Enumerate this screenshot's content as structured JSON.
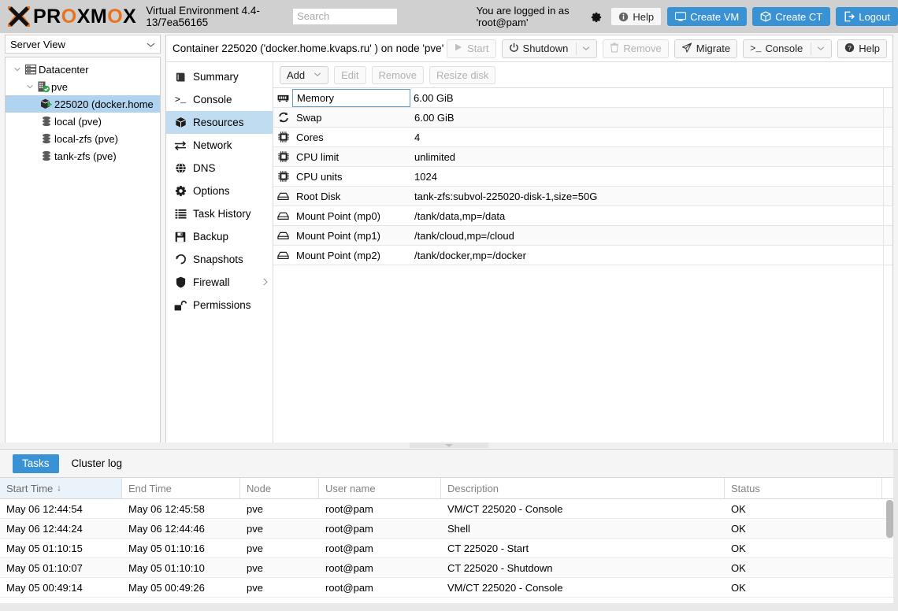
{
  "header": {
    "brand_black": "PR",
    "brand_orange_1": "O",
    "brand_black_2": "XM",
    "brand_orange_2": "O",
    "brand_black_3": "X",
    "wordmark": "PROXMOX",
    "product_name": "Virtual Environment 4.4-13/7ea56165",
    "search_placeholder": "Search",
    "search_value": "",
    "login_text": "You are logged in as 'root@pam'",
    "gear_icon": "gear-icon",
    "buttons": [
      {
        "label": "Help",
        "icon": "info-icon",
        "style": "light"
      },
      {
        "label": "Create VM",
        "icon": "monitor-icon",
        "style": "blue"
      },
      {
        "label": "Create CT",
        "icon": "cube-icon",
        "style": "blue"
      },
      {
        "label": "Logout",
        "icon": "logout-icon",
        "style": "blue"
      }
    ],
    "accent_color": "#3892d4",
    "brand_color": "#e8731c",
    "bar_color": "#d0d0d0"
  },
  "sidebar": {
    "view_selector": "Server View",
    "tree": [
      {
        "label": "Datacenter",
        "icon": "datacenter-icon",
        "indent": 0,
        "expanded": true,
        "selected": false
      },
      {
        "label": "pve",
        "icon": "node-icon",
        "indent": 1,
        "expanded": true,
        "selected": false
      },
      {
        "label": "225020 (docker.home",
        "icon": "container-icon",
        "indent": 2,
        "expanded": false,
        "selected": true
      },
      {
        "label": "local (pve)",
        "icon": "storage-icon",
        "indent": 2,
        "expanded": false,
        "selected": false
      },
      {
        "label": "local-zfs (pve)",
        "icon": "storage-icon",
        "indent": 2,
        "expanded": false,
        "selected": false
      },
      {
        "label": "tank-zfs (pve)",
        "icon": "storage-icon",
        "indent": 2,
        "expanded": false,
        "selected": false
      }
    ]
  },
  "content": {
    "title": "Container 225020 ('docker.home.kvaps.ru' ) on node 'pve'",
    "toolbar": [
      {
        "label": "Start",
        "icon": "play-icon",
        "disabled": true,
        "split": false
      },
      {
        "label": "Shutdown",
        "icon": "power-icon",
        "disabled": false,
        "split": true
      },
      {
        "label": "Remove",
        "icon": "trash-icon",
        "disabled": true,
        "split": false
      },
      {
        "label": "Migrate",
        "icon": "migrate-icon",
        "disabled": false,
        "split": false
      },
      {
        "label": "Console",
        "icon": "terminal-icon",
        "disabled": false,
        "split": true
      },
      {
        "label": "Help",
        "icon": "help-icon",
        "disabled": false,
        "split": false
      }
    ],
    "menu": [
      {
        "label": "Summary",
        "icon": "summary-icon",
        "selected": false,
        "submenu": false
      },
      {
        "label": "Console",
        "icon": "terminal-icon",
        "selected": false,
        "submenu": false
      },
      {
        "label": "Resources",
        "icon": "cube-icon",
        "selected": true,
        "submenu": false
      },
      {
        "label": "Network",
        "icon": "network-icon",
        "selected": false,
        "submenu": false
      },
      {
        "label": "DNS",
        "icon": "globe-icon",
        "selected": false,
        "submenu": false
      },
      {
        "label": "Options",
        "icon": "gear-icon",
        "selected": false,
        "submenu": false
      },
      {
        "label": "Task History",
        "icon": "list-icon",
        "selected": false,
        "submenu": false
      },
      {
        "label": "Backup",
        "icon": "floppy-icon",
        "selected": false,
        "submenu": false
      },
      {
        "label": "Snapshots",
        "icon": "history-icon",
        "selected": false,
        "submenu": false
      },
      {
        "label": "Firewall",
        "icon": "shield-icon",
        "selected": false,
        "submenu": true
      },
      {
        "label": "Permissions",
        "icon": "unlock-icon",
        "selected": false,
        "submenu": false
      }
    ],
    "grid_toolbar": [
      {
        "label": "Add",
        "disabled": false,
        "split": true
      },
      {
        "label": "Edit",
        "disabled": true,
        "split": false
      },
      {
        "label": "Remove",
        "disabled": true,
        "split": false
      },
      {
        "label": "Resize disk",
        "disabled": true,
        "split": false
      }
    ],
    "resources": [
      {
        "icon": "memory-icon",
        "key": "Memory",
        "value": "6.00 GiB",
        "focused": true
      },
      {
        "icon": "swap-icon",
        "key": "Swap",
        "value": "6.00 GiB",
        "focused": false
      },
      {
        "icon": "cpu-icon",
        "key": "Cores",
        "value": "4",
        "focused": false
      },
      {
        "icon": "cpu-icon",
        "key": "CPU limit",
        "value": "unlimited",
        "focused": false
      },
      {
        "icon": "cpu-icon",
        "key": "CPU units",
        "value": "1024",
        "focused": false
      },
      {
        "icon": "disk-icon",
        "key": "Root Disk",
        "value": "tank-zfs:subvol-225020-disk-1,size=50G",
        "focused": false
      },
      {
        "icon": "disk-icon",
        "key": "Mount Point (mp0)",
        "value": "/tank/data,mp=/data",
        "focused": false
      },
      {
        "icon": "disk-icon",
        "key": "Mount Point (mp1)",
        "value": "/tank/cloud,mp=/cloud",
        "focused": false
      },
      {
        "icon": "disk-icon",
        "key": "Mount Point (mp2)",
        "value": "/tank/docker,mp=/docker",
        "focused": false
      }
    ]
  },
  "bottom": {
    "tabs": [
      {
        "label": "Tasks",
        "active": true
      },
      {
        "label": "Cluster log",
        "active": false
      }
    ],
    "columns": [
      {
        "label": "Start Time",
        "sorted": true,
        "sort_dir": "↓"
      },
      {
        "label": "End Time",
        "sorted": false,
        "sort_dir": ""
      },
      {
        "label": "Node",
        "sorted": false,
        "sort_dir": ""
      },
      {
        "label": "User name",
        "sorted": false,
        "sort_dir": ""
      },
      {
        "label": "Description",
        "sorted": false,
        "sort_dir": ""
      },
      {
        "label": "Status",
        "sorted": false,
        "sort_dir": ""
      }
    ],
    "rows": [
      {
        "start": "May 06 12:44:54",
        "end": "May 06 12:45:58",
        "node": "pve",
        "user": "root@pam",
        "desc": "VM/CT 225020 - Console",
        "status": "OK"
      },
      {
        "start": "May 06 12:44:24",
        "end": "May 06 12:44:46",
        "node": "pve",
        "user": "root@pam",
        "desc": "Shell",
        "status": "OK"
      },
      {
        "start": "May 05 01:10:15",
        "end": "May 05 01:10:16",
        "node": "pve",
        "user": "root@pam",
        "desc": "CT 225020 - Start",
        "status": "OK"
      },
      {
        "start": "May 05 01:10:07",
        "end": "May 05 01:10:10",
        "node": "pve",
        "user": "root@pam",
        "desc": "CT 225020 - Shutdown",
        "status": "OK"
      },
      {
        "start": "May 05 00:49:14",
        "end": "May 05 00:49:26",
        "node": "pve",
        "user": "root@pam",
        "desc": "VM/CT 225020 - Console",
        "status": "OK"
      }
    ]
  }
}
